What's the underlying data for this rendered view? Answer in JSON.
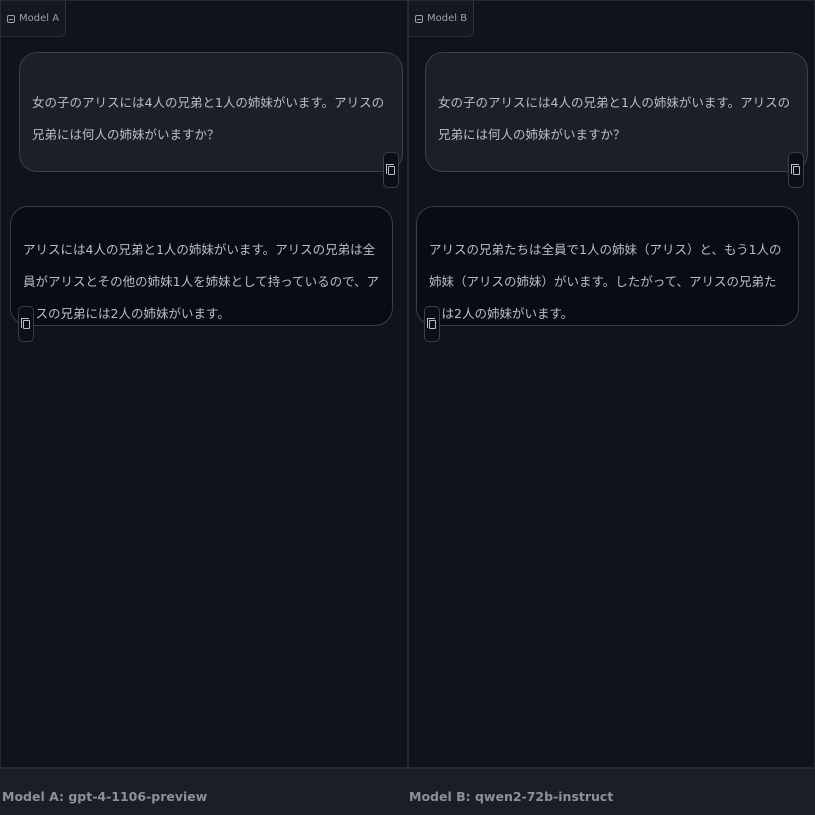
{
  "panels": [
    {
      "tab_label": "Model A",
      "prompt": "女の子のアリスには4人の兄弟と1人の姉妹がいます。アリスの兄弟には何人の姉妹がいますか？",
      "response": "アリスには4人の兄弟と1人の姉妹がいます。アリスの兄弟は全員がアリスとその他の姉妹1人を姉妹として持っているので、アリスの兄弟には2人の姉妹がいます。"
    },
    {
      "tab_label": "Model B",
      "prompt": "女の子のアリスには4人の兄弟と1人の姉妹がいます。アリスの兄弟には何人の姉妹がいますか？",
      "response": "アリスの兄弟たちは全員で1人の姉妹（アリス）と、もう1人の姉妹（アリスの姉妹）がいます。したがって、アリスの兄弟たちは2人の姉妹がいます。"
    }
  ],
  "footer": {
    "model_a": "Model A: gpt-4-1106-preview",
    "model_b": "Model B: qwen2-72b-instruct"
  },
  "icons": {
    "tab": "chat-icon",
    "copy": "copy-icon"
  },
  "colors": {
    "background": "#0f1219",
    "user_bubble": "#1b1f27",
    "bot_bubble": "#090c12",
    "border": "#3a3f49",
    "text": "#b9bdc4"
  }
}
